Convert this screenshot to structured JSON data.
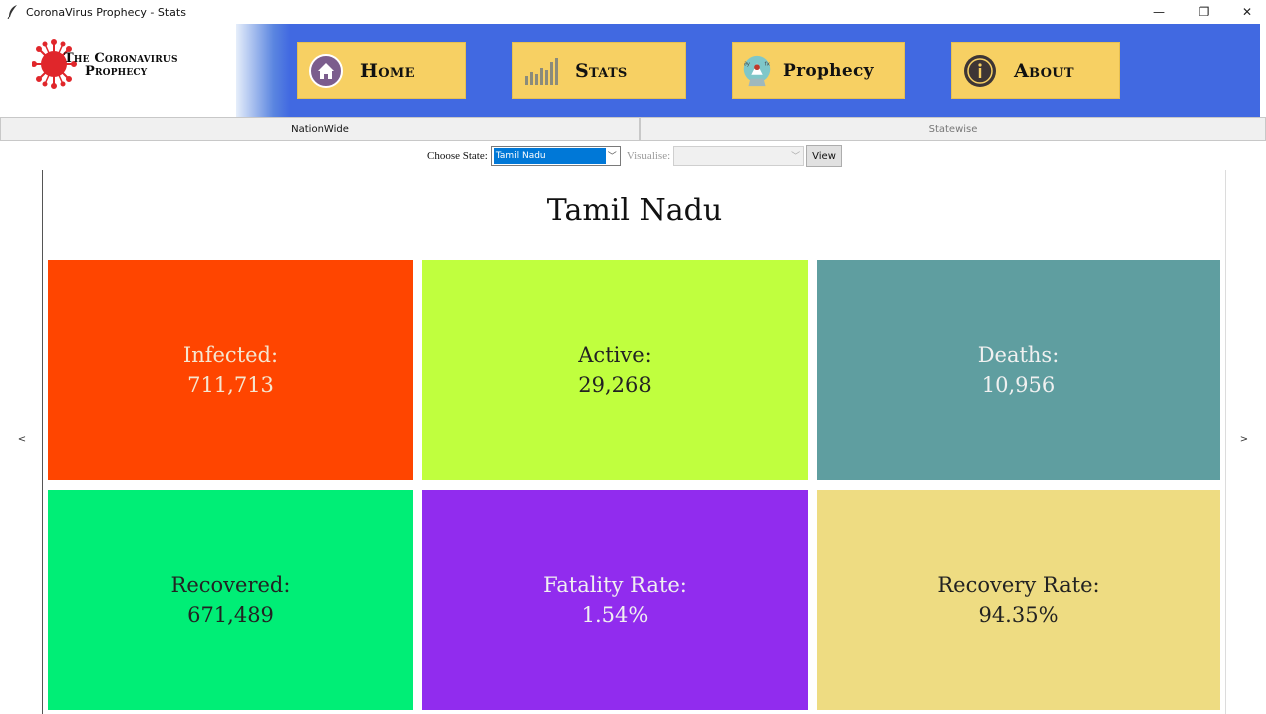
{
  "window": {
    "title": "CoronaVirus Prophecy - Stats",
    "minimize": "—",
    "restore": "❐",
    "close": "✕"
  },
  "logo": {
    "line1": "The Coronavirus",
    "line2": "Prophecy"
  },
  "nav": {
    "home": "Home",
    "stats": "Stats",
    "prophecy": "Prophecy",
    "about": "About"
  },
  "tabs": {
    "nationwide": "NationWide",
    "statewise": "Statewise"
  },
  "controls": {
    "choose_state_label": "Choose State:",
    "state_value": "Tamil Nadu",
    "visualise_label": "Visualise:",
    "visualise_value": "",
    "view_button": "View"
  },
  "pager": {
    "prev": "<",
    "next": ">"
  },
  "state_title": "Tamil Nadu",
  "cards": [
    {
      "label": "Infected:",
      "value": "711,713",
      "bg": "#ff4500",
      "fg": "#f5e6d0"
    },
    {
      "label": "Active:",
      "value": "29,268",
      "bg": "#c0ff3e",
      "fg": "#222222"
    },
    {
      "label": "Deaths:",
      "value": "10,956",
      "bg": "#5f9ea0",
      "fg": "#f0f0f0"
    },
    {
      "label": "Recovered:",
      "value": "671,489",
      "bg": "#00ee76",
      "fg": "#222222"
    },
    {
      "label": "Fatality Rate:",
      "value": "1.54%",
      "bg": "#912cee",
      "fg": "#f0f0f0"
    },
    {
      "label": "Recovery Rate:",
      "value": "94.35%",
      "bg": "#eedc82",
      "fg": "#222222"
    }
  ],
  "colors": {
    "navbar": "#4169e1",
    "nav_button": "#f7d063",
    "selection": "#0078d7"
  }
}
